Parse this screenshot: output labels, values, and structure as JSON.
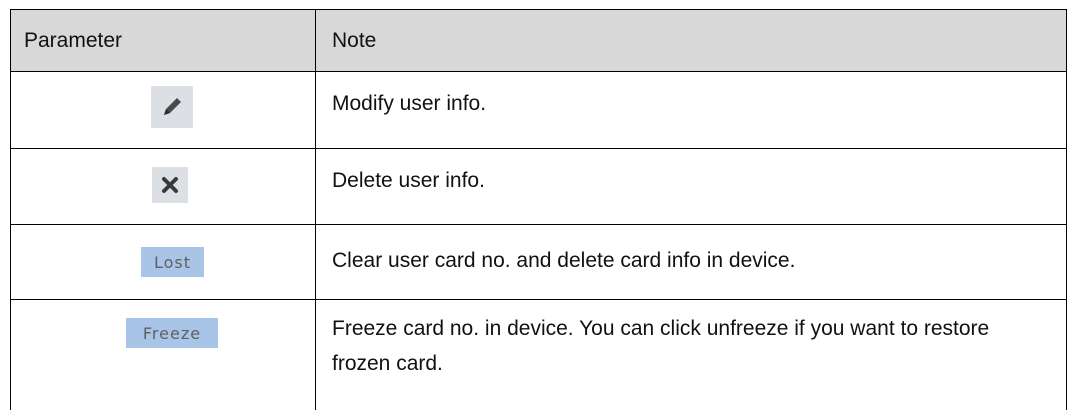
{
  "table": {
    "headers": {
      "parameter": "Parameter",
      "note": "Note"
    },
    "rows": [
      {
        "icon": "pencil-icon",
        "note": "Modify user info."
      },
      {
        "icon": "close-icon",
        "note": "Delete user info."
      },
      {
        "button_label": "Lost",
        "note": "Clear user card no. and delete card info in device."
      },
      {
        "button_label": "Freeze",
        "note": "Freeze card no. in device. You can click unfreeze if you want to restore frozen card."
      }
    ]
  },
  "colors": {
    "header_bg": "#d8d8d8",
    "icon_button_bg": "#dcdfe4",
    "text_button_bg": "#a8c4e6",
    "text_button_fg": "#606060"
  }
}
